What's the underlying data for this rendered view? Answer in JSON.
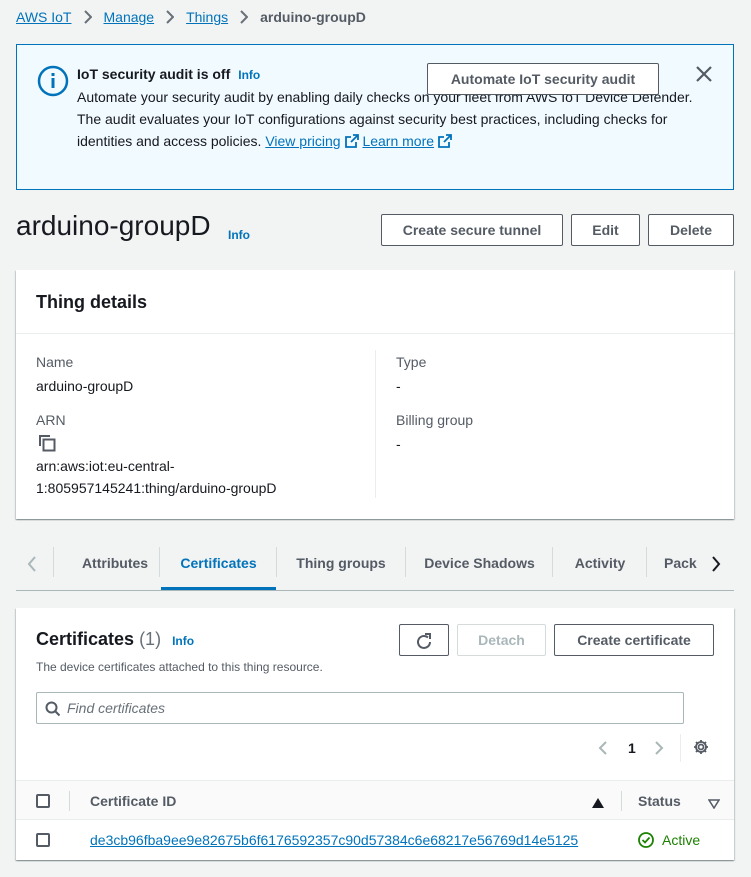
{
  "breadcrumb": {
    "items": [
      "AWS IoT",
      "Manage",
      "Things"
    ],
    "current": "arduino-groupD"
  },
  "banner": {
    "title": "IoT security audit is off",
    "info": "Info",
    "text": "Automate your security audit by enabling daily checks on your fleet from AWS IoT Device Defender. The audit evaluates your IoT configurations against security best practices, including checks for identities and access policies.",
    "view_pricing": "View pricing",
    "learn_more": "Learn more",
    "button": "Automate IoT security audit",
    "icons": [
      "info-circle-icon",
      "close-icon",
      "external-link-icon"
    ]
  },
  "header": {
    "title": "arduino-groupD",
    "info": "Info",
    "buttons": {
      "tunnel": "Create secure tunnel",
      "edit": "Edit",
      "delete": "Delete"
    }
  },
  "details": {
    "heading": "Thing details",
    "name_label": "Name",
    "name_value": "arduino-groupD",
    "arn_label": "ARN",
    "arn_line1": "arn:aws:iot:eu-central-",
    "arn_line2": "1:805957145241:thing/arduino-groupD",
    "type_label": "Type",
    "type_value": "-",
    "billing_label": "Billing group",
    "billing_value": "-"
  },
  "tabs": {
    "items": [
      "Attributes",
      "Certificates",
      "Thing groups",
      "Device Shadows",
      "Activity",
      "Pack"
    ],
    "active": "Certificates"
  },
  "certificates": {
    "title": "Certificates",
    "count": "(1)",
    "info": "Info",
    "description": "The device certificates attached to this thing resource.",
    "buttons": {
      "detach": "Detach",
      "create": "Create certificate"
    },
    "search_placeholder": "Find certificates",
    "page": "1",
    "columns": {
      "id": "Certificate ID",
      "status": "Status"
    },
    "rows": [
      {
        "id": "de3cb96fba9ee9e82675b6f6176592357c90d57384c6e68217e56769d14e5125",
        "status": "Active"
      }
    ]
  },
  "colors": {
    "link": "#0073bb",
    "success": "#1d8102",
    "banner_bg": "#f1faff",
    "text": "#16191f",
    "muted": "#545b64"
  }
}
